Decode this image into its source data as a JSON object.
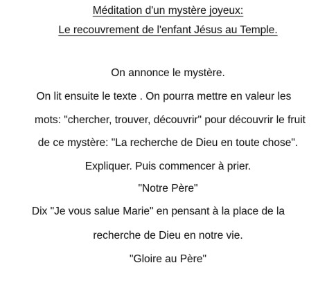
{
  "title": {
    "line1": "Méditation d'un mystère joyeux:",
    "line2": "Le recouvrement de l'enfant Jésus au Temple."
  },
  "body": {
    "lines": [
      "On annonce le mystère.",
      "On lit ensuite le texte . On pourra mettre en valeur les",
      "mots: \"chercher, trouver, découvrir\" pour découvrir le fruit",
      "de ce mystère: \"La recherche de Dieu en toute chose\".",
      "Expliquer. Puis commencer à prier.",
      "\"Notre Père\"",
      "Dix \"Je vous salue Marie\" en pensant à la place de la",
      "recherche de Dieu en notre vie.",
      "\"Gloire au Père\""
    ]
  },
  "colors": {
    "underline": "#c0282d",
    "text": "#1a1a1a",
    "background": "#ffffff"
  }
}
